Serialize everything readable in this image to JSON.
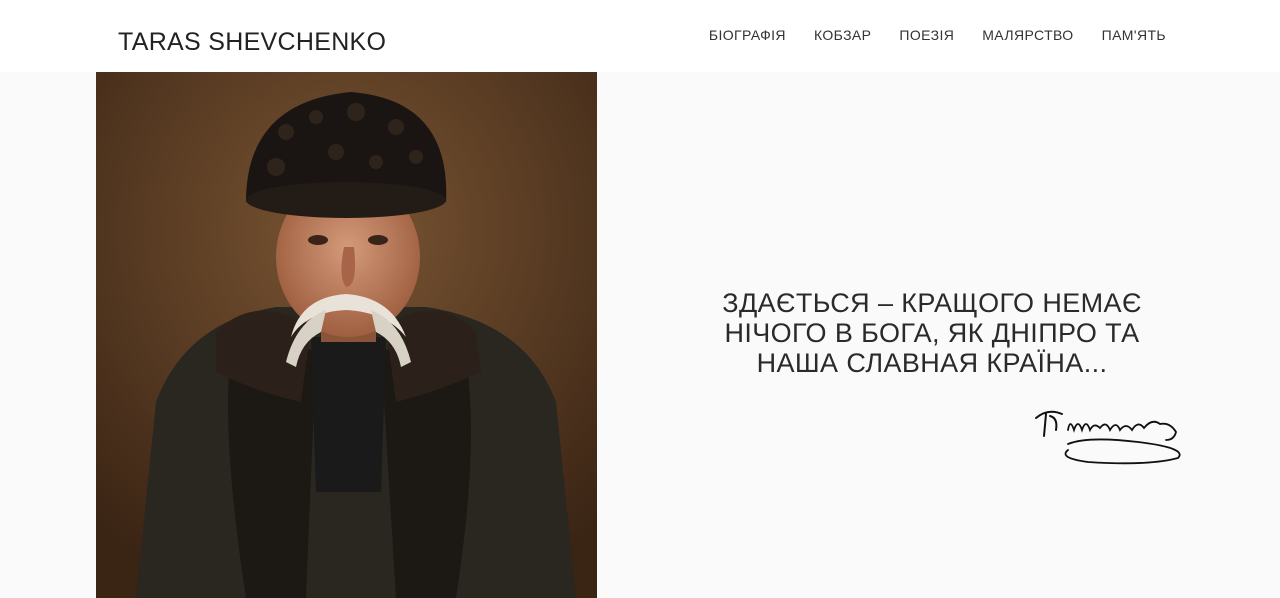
{
  "header": {
    "logo": "TARAS SHEVCHENKO",
    "nav": [
      "БІОГРАФІЯ",
      "КОБЗАР",
      "ПОЕЗІЯ",
      "МАЛЯРСТВО",
      "ПАМ'ЯТЬ"
    ]
  },
  "hero": {
    "quote": "ЗДАЄТЬСЯ – КРАЩОГО НЕМАЄ НІЧОГО В БОГА, ЯК ДНІПРО ТА НАША СЛАВНАЯ КРАЇНА...",
    "signature_text": "Т. Шевченко"
  },
  "colors": {
    "background": "#fafafa",
    "header": "#ffffff",
    "text": "#222222"
  }
}
